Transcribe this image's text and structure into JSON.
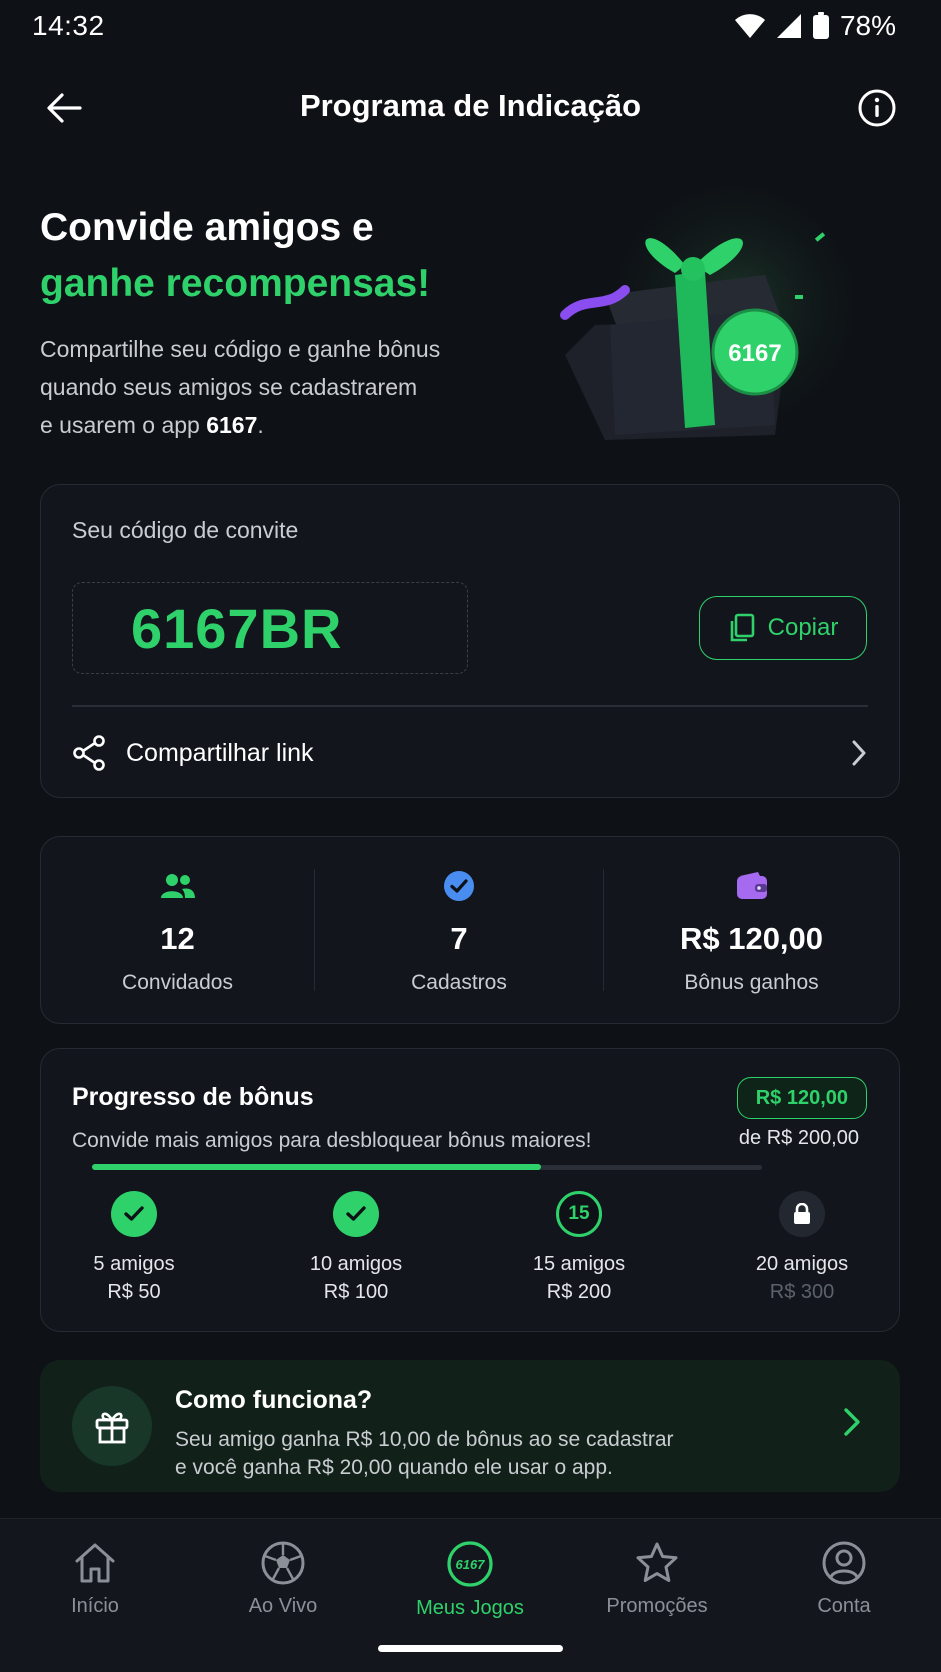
{
  "status_bar": {
    "time": "14:32",
    "battery": "78%"
  },
  "header": {
    "title": "Programa de Indicação"
  },
  "hero": {
    "title_line1": "Convide amigos e",
    "title_line2": "ganhe recompensas!",
    "desc_line1": "Compartilhe seu código e ganhe bônus",
    "desc_line2": "quando seus amigos se cadastrarem",
    "desc_line3_prefix": "e usarem o app ",
    "desc_line3_app": "6167",
    "desc_line3_suffix": ".",
    "badge": "6167"
  },
  "invite": {
    "label": "Seu código de convite",
    "code": "6167BR",
    "copy_label": "Copiar",
    "share_label": "Compartilhar link"
  },
  "stats": [
    {
      "value": "12",
      "label": "Convidados",
      "icon": "users-icon",
      "color": "#2fd16a"
    },
    {
      "value": "7",
      "label": "Cadastros",
      "icon": "check-circle-icon",
      "color": "#4a8df0"
    },
    {
      "value": "R$ 120,00",
      "label": "Bônus ganhos",
      "icon": "wallet-icon",
      "color": "#a66af0"
    }
  ],
  "progress": {
    "title": "Progresso de bônus",
    "subtitle": "Convide mais amigos para desbloquear bônus maiores!",
    "earned": "R$ 120,00",
    "of_total": "de R$ 200,00",
    "fill_fraction": 0.67,
    "milestones": [
      {
        "friends": "5 amigos",
        "reward": "R$ 50",
        "state": "done"
      },
      {
        "friends": "10 amigos",
        "reward": "R$ 100",
        "state": "done"
      },
      {
        "friends": "15 amigos",
        "reward": "R$ 200",
        "state": "current",
        "badge": "15"
      },
      {
        "friends": "20 amigos",
        "reward": "R$ 300",
        "state": "locked"
      }
    ]
  },
  "how_it_works": {
    "title": "Como funciona?",
    "line1": "Seu amigo ganha R$ 10,00 de bônus ao se cadastrar",
    "line2": "e você ganha R$ 20,00 quando ele usar o app."
  },
  "nav": [
    {
      "label": "Início",
      "icon": "home-icon"
    },
    {
      "label": "Ao Vivo",
      "icon": "soccer-ball-icon"
    },
    {
      "label": "Meus Jogos",
      "icon": "brand-6167-icon",
      "badge": "6167",
      "active": true
    },
    {
      "label": "Promoções",
      "icon": "star-icon"
    },
    {
      "label": "Conta",
      "icon": "user-circle-icon"
    }
  ],
  "colors": {
    "accent": "#2fd16a",
    "background": "#0e1116",
    "card": "#12161c"
  }
}
